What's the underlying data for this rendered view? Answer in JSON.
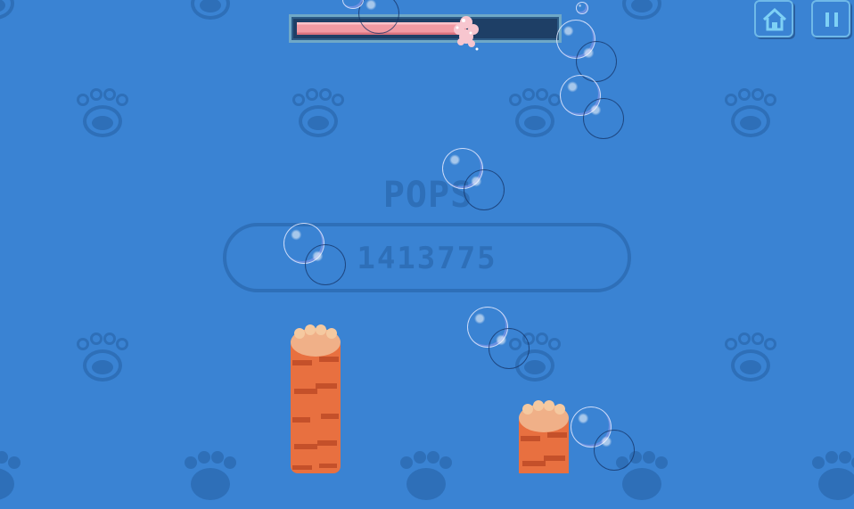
{
  "hud": {
    "progress_fraction": 0.66,
    "home_icon": "home-icon",
    "pause_icon": "pause-icon"
  },
  "score": {
    "label": "POPS",
    "value": "1413775"
  },
  "colors": {
    "background": "#3a83d3",
    "paw_pattern": "#2e6fb8",
    "progress_fill": "#f29aa3",
    "progress_track": "#1e3f66",
    "cat_fur": "#e87040",
    "cat_stripe": "#c4502a",
    "toe_beans": "#f5b38a"
  },
  "sprites": {
    "background_pattern": "paw-print-icon",
    "player": "cat-paw",
    "targets": "soap-bubble"
  }
}
